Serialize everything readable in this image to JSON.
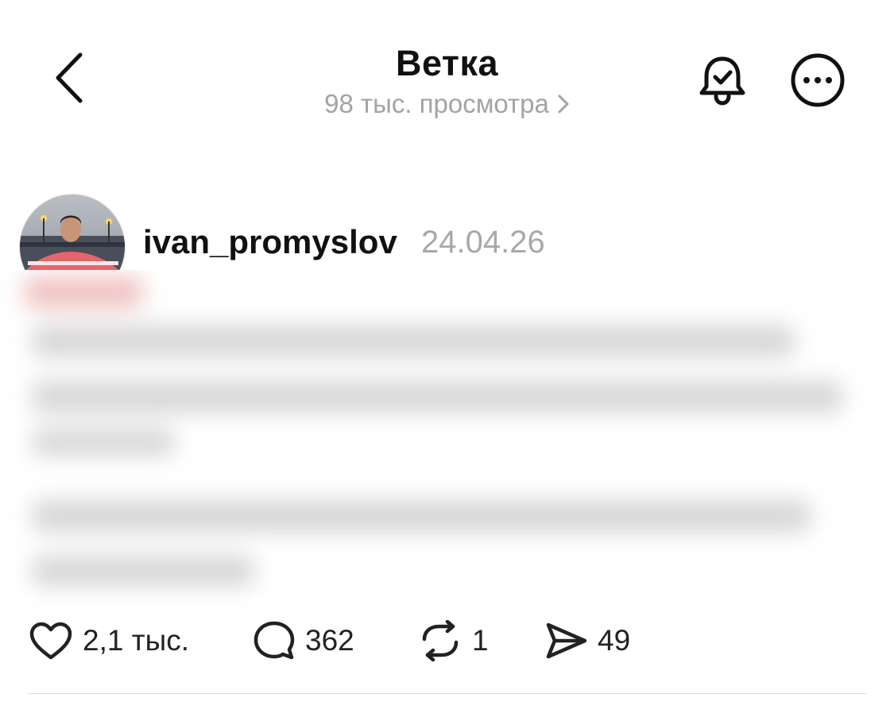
{
  "header": {
    "title": "Ветка",
    "views": "98 тыс. просмотра"
  },
  "post": {
    "username": "ivan_promyslov",
    "date": "24.04.26"
  },
  "actions": {
    "likes": "2,1 тыс.",
    "comments": "362",
    "reposts": "1",
    "shares": "49"
  },
  "icons": {
    "back": "chevron-left-icon",
    "views_more": "chevron-right-icon",
    "bell": "bell-check-icon",
    "more": "more-horizontal-icon",
    "like": "heart-icon",
    "comment": "comment-icon",
    "repost": "repost-icon",
    "share": "send-icon"
  },
  "colors": {
    "text": "#111111",
    "muted": "#a3a3a3",
    "divider": "#dcdcdc"
  }
}
